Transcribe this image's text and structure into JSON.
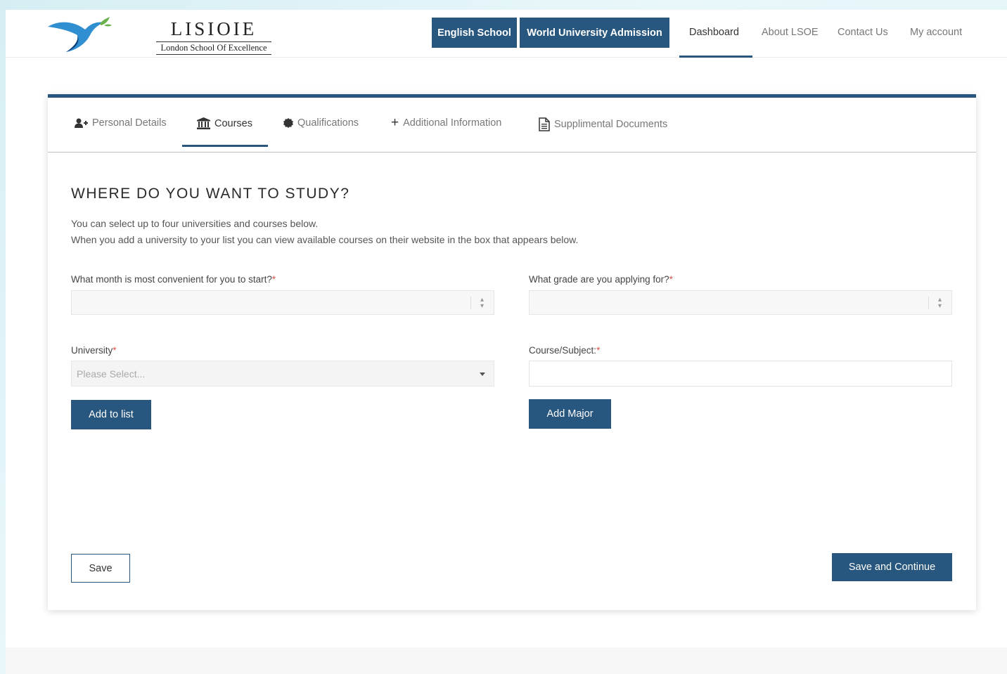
{
  "brand": {
    "title": "LISIOIE",
    "subtitle": "London School Of Excellence"
  },
  "header": {
    "buttons": [
      "English School",
      "World University Admission"
    ],
    "nav": [
      "Dashboard",
      "About LSOE",
      "Contact Us",
      "My account"
    ],
    "active_nav": "Dashboard"
  },
  "tabs": [
    {
      "label": "Personal Details",
      "icon": "user-plus-icon"
    },
    {
      "label": "Courses",
      "icon": "institution-icon"
    },
    {
      "label": "Qualifications",
      "icon": "badge-icon"
    },
    {
      "label": "Additional Information",
      "icon": "plus-icon"
    },
    {
      "label": "Supplimental Documents",
      "icon": "document-icon"
    }
  ],
  "active_tab": "Courses",
  "form": {
    "title": "WHERE DO YOU WANT TO STUDY?",
    "intro_line1": "You can select up to four universities and courses below.",
    "intro_line2": "When you add a university to your list you can view available courses on their website in the box that appears below.",
    "month_label": "What month is most convenient for you to start?",
    "grade_label": "What grade are you applying for?",
    "university_label": "University",
    "university_placeholder": "Please Select...",
    "course_label": "Course/Subject:",
    "required_mark": "*",
    "add_to_list": "Add to list",
    "add_major": "Add Major",
    "save": "Save",
    "save_continue": "Save and Continue"
  },
  "colors": {
    "primary": "#27567e",
    "required": "#d9534f"
  }
}
